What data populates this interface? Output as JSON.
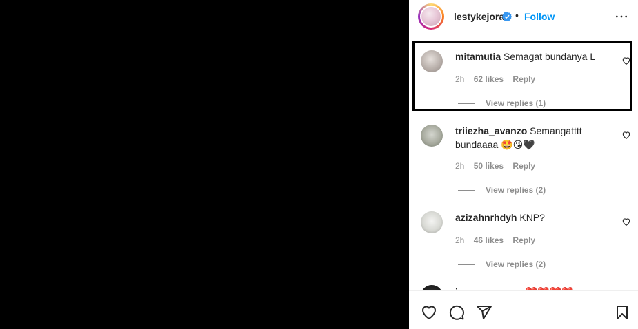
{
  "post": {
    "username": "lestykejora",
    "separator": "•",
    "follow_label": "Follow",
    "verified_icon": "verified-badge-icon",
    "accent_color": "#0095f6"
  },
  "comments": [
    {
      "username": "mitamutia",
      "text": "Semagat bundanya L",
      "time": "2h",
      "likes": "62 likes",
      "reply_label": "Reply",
      "view_replies": "View replies (1)"
    },
    {
      "username": "triiezha_avanzo",
      "text": "Semangatttt bundaaaa 🤩😘🖤",
      "time": "2h",
      "likes": "50 likes",
      "reply_label": "Reply",
      "view_replies": "View replies (2)"
    },
    {
      "username": "azizahnrhdyh",
      "text": "KNP?",
      "time": "2h",
      "likes": "46 likes",
      "reply_label": "Reply",
      "view_replies": "View replies (2)"
    },
    {
      "username": "i",
      "text": "❤️❤️❤️❤️"
    }
  ],
  "actions": {
    "like_icon": "heart-icon",
    "comment_icon": "comment-icon",
    "share_icon": "share-icon",
    "save_icon": "bookmark-icon"
  }
}
